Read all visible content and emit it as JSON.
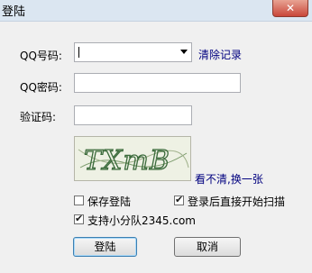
{
  "window": {
    "title": "登陆",
    "close_glyph": "✕"
  },
  "form": {
    "qq_number_label": "QQ号码:",
    "qq_password_label": "QQ密码:",
    "captcha_label": "验证码:",
    "qq_number_value": "",
    "qq_password_value": "",
    "captcha_value": "",
    "clear_record_link": "清除记录",
    "refresh_captcha_link": "看不清,换一张",
    "captcha_text": "TXmB"
  },
  "options": {
    "save_login": {
      "label": "保存登陆",
      "checked": false
    },
    "auto_scan": {
      "label": "登录后直接开始扫描",
      "checked": true
    },
    "support_team": {
      "label": "支持小分队2345.com",
      "checked": true
    }
  },
  "buttons": {
    "login": "登陆",
    "cancel": "取消"
  },
  "icons": {
    "dropdown": "chevron-down-icon",
    "close": "close-icon",
    "checkmark": "checkmark-icon"
  },
  "colors": {
    "link": "#00007f",
    "titlebar": "#dbe6f1",
    "close": "#c9473a"
  }
}
